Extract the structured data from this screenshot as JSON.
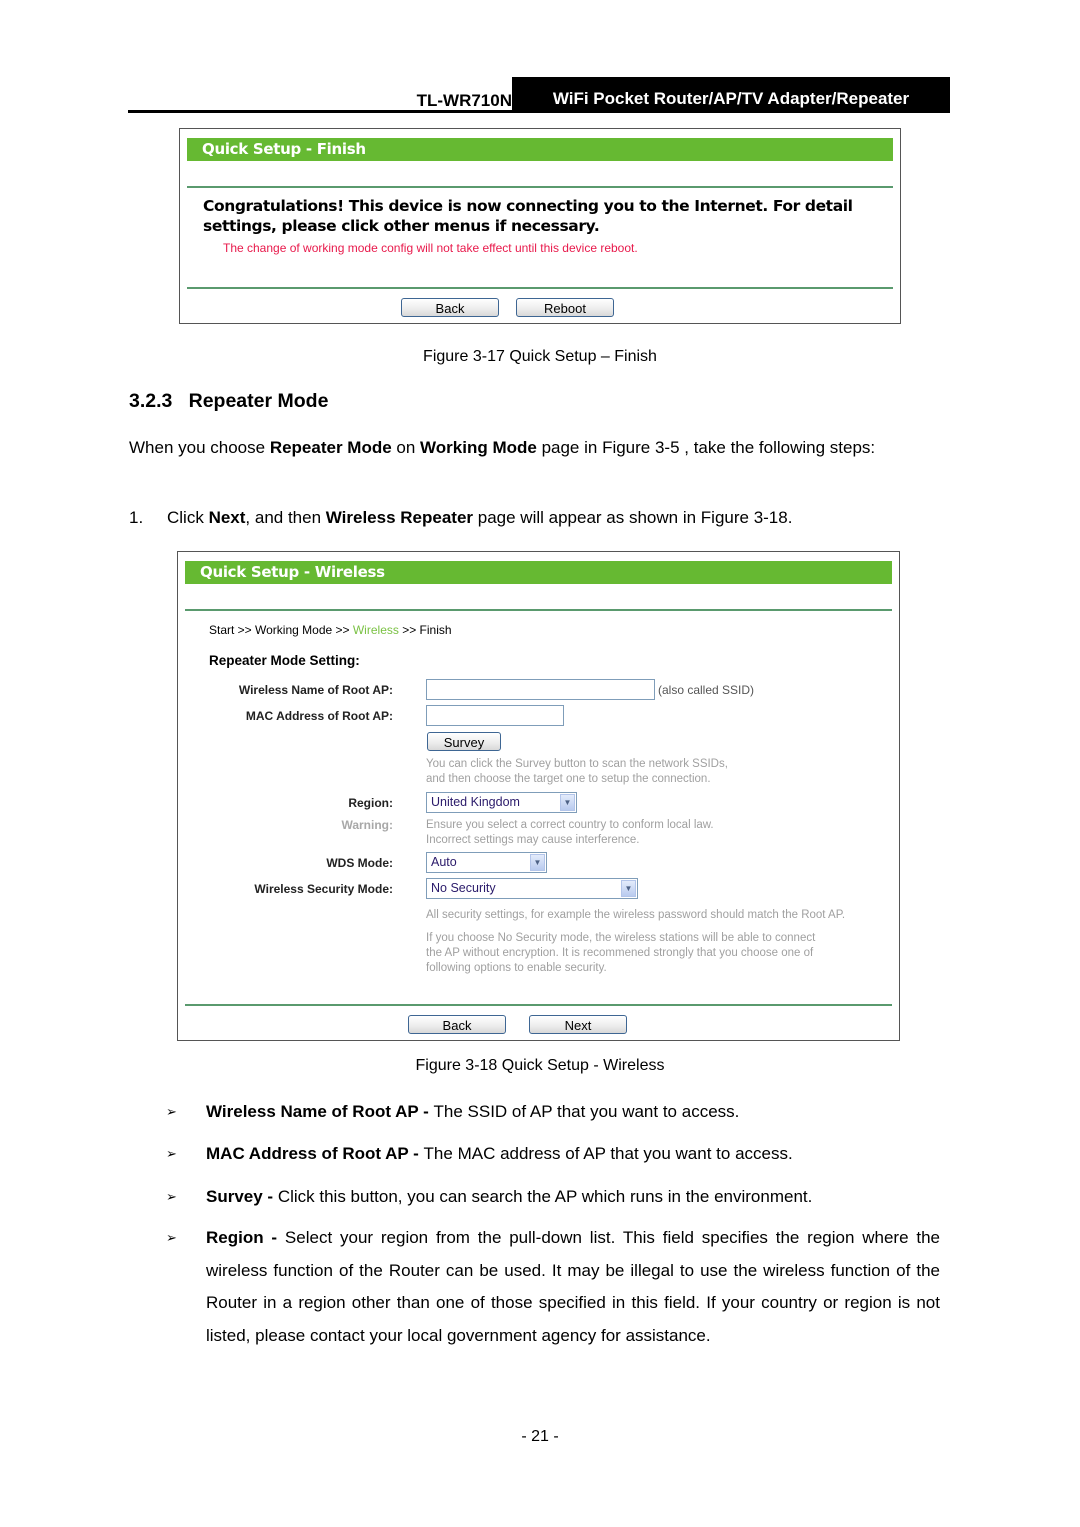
{
  "header": {
    "model": "TL-WR710N",
    "title": "WiFi Pocket Router/AP/TV Adapter/Repeater"
  },
  "figure17": {
    "bar_title": "Quick Setup - Finish",
    "message": "Congratulations! This device is now connecting you to the Internet. For detail settings, please click other menus if necessary.",
    "warning": "The change of working mode config will not take effect until this device reboot.",
    "back_label": "Back",
    "reboot_label": "Reboot",
    "caption": "Figure 3-17 Quick Setup – Finish"
  },
  "section": {
    "heading": "3.2.3   Repeater Mode",
    "intro": {
      "t1": "When you choose ",
      "b1": "Repeater Mode",
      "t2": " on ",
      "b2": "Working Mode",
      "t3": " page in Figure 3-5 , take the following steps:"
    },
    "step1": {
      "num": "1.",
      "t1": "Click ",
      "b1": "Next",
      "t2": ", and then ",
      "b2": "Wireless Repeater",
      "t3": " page will appear as shown in Figure 3-18."
    }
  },
  "figure18": {
    "bar_title": "Quick Setup - Wireless",
    "breadcrumb": {
      "start": "Start >> Working Mode >> ",
      "current": "Wireless",
      "end": " >> Finish"
    },
    "section_title": "Repeater Mode Setting:",
    "fields": {
      "ssid_label": "Wireless Name of Root AP:",
      "ssid_value": "",
      "ssid_note": "(also called SSID)",
      "mac_label": "MAC Address of Root AP:",
      "mac_value": "",
      "survey_label": "Survey",
      "survey_hint_1": "You can click the Survey button to scan the network SSIDs,",
      "survey_hint_2": "and then choose the target one to setup the connection.",
      "region_label": "Region:",
      "region_value": "United Kingdom",
      "warning_label": "Warning:",
      "warning_1": "Ensure you select a correct country to conform local law.",
      "warning_2": "Incorrect settings may cause interference.",
      "wds_label": "WDS Mode:",
      "wds_value": "Auto",
      "security_label": "Wireless Security Mode:",
      "security_value": "No Security",
      "security_note": "All security settings, for example the wireless password should match the Root AP.",
      "nosec_1": "If you choose No Security mode, the wireless stations will be able to connect",
      "nosec_2": "the AP without encryption. It is recommened strongly that you choose one of",
      "nosec_3": "following options to enable security."
    },
    "back_label": "Back",
    "next_label": "Next",
    "caption": "Figure 3-18 Quick Setup - Wireless"
  },
  "bullets": [
    {
      "term": "Wireless Name of Root AP - ",
      "desc": "The SSID of AP that you want to access."
    },
    {
      "term": "MAC Address of Root AP - ",
      "desc": "The MAC address of AP that you want to access."
    },
    {
      "term": "Survey - ",
      "desc": "Click this button, you can search the AP which runs in the environment."
    },
    {
      "term": "Region - ",
      "desc": "Select your region from the pull-down list. This field specifies the region where the wireless function of the Router can be used. It may be illegal to use the wireless function of the Router in a region other than one of those specified in this field. If your country or region is not listed, please contact your local government agency for assistance."
    }
  ],
  "bullet_marker": "➢",
  "page_number": "- 21 -"
}
